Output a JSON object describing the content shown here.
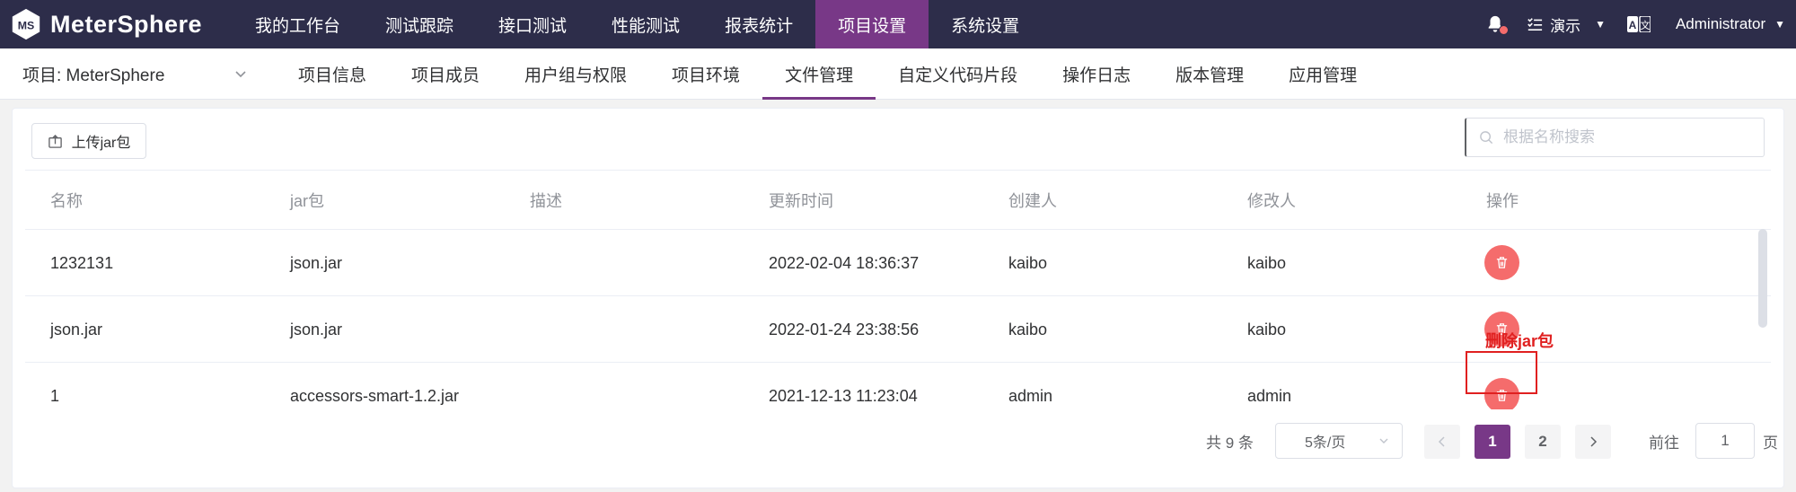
{
  "app": {
    "name": "MeterSphere"
  },
  "top_menu": [
    {
      "label": "我的工作台",
      "active": false
    },
    {
      "label": "测试跟踪",
      "active": false
    },
    {
      "label": "接口测试",
      "active": false
    },
    {
      "label": "性能测试",
      "active": false
    },
    {
      "label": "报表统计",
      "active": false
    },
    {
      "label": "项目设置",
      "active": true
    },
    {
      "label": "系统设置",
      "active": false
    }
  ],
  "top_right": {
    "workspace": "演示",
    "user": "Administrator",
    "bell_icon": "bell-icon",
    "workspace_icon": "list-check-icon",
    "lang_icon": "language-icon"
  },
  "project": {
    "label": "项目: MeterSphere"
  },
  "sub_tabs": [
    {
      "label": "项目信息",
      "active": false
    },
    {
      "label": "项目成员",
      "active": false
    },
    {
      "label": "用户组与权限",
      "active": false
    },
    {
      "label": "项目环境",
      "active": false
    },
    {
      "label": "文件管理",
      "active": true
    },
    {
      "label": "自定义代码片段",
      "active": false
    },
    {
      "label": "操作日志",
      "active": false
    },
    {
      "label": "版本管理",
      "active": false
    },
    {
      "label": "应用管理",
      "active": false
    }
  ],
  "toolbar": {
    "upload_label": "上传jar包",
    "search_placeholder": "根据名称搜索"
  },
  "table": {
    "columns": [
      "名称",
      "jar包",
      "描述",
      "更新时间",
      "创建人",
      "修改人",
      "操作"
    ],
    "rows": [
      {
        "name": "1232131",
        "jar": "json.jar",
        "desc": "",
        "updated": "2022-02-04 18:36:37",
        "creator": "kaibo",
        "modifier": "kaibo"
      },
      {
        "name": "json.jar",
        "jar": "json.jar",
        "desc": "",
        "updated": "2022-01-24 23:38:56",
        "creator": "kaibo",
        "modifier": "kaibo"
      },
      {
        "name": "1",
        "jar": "accessors-smart-1.2.jar",
        "desc": "",
        "updated": "2021-12-13 11:23:04",
        "creator": "admin",
        "modifier": "admin"
      }
    ]
  },
  "annotation": {
    "label": "删除jar包"
  },
  "pagination": {
    "total": "共 9 条",
    "page_size": "5条/页",
    "pages": [
      "1",
      "2"
    ],
    "current_page": "1",
    "goto_label": "前往",
    "goto_value": "1",
    "page_suffix": "页"
  },
  "colors": {
    "nav_bg": "#2d2d4a",
    "accent": "#783887",
    "danger": "#f56c6c",
    "annotation": "#e02020"
  }
}
